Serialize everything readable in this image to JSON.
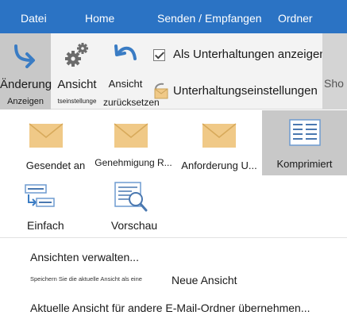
{
  "menubar": {
    "tabs": [
      "Datei",
      "Home",
      "Senden / Empfangen",
      "Ordner"
    ]
  },
  "ribbon": {
    "change_view": {
      "label_top": "Änderung",
      "label_bottom": "Anzeigen",
      "icon": "change-view-arrow-icon"
    },
    "view_settings": {
      "label_top": "Ansicht",
      "label_bottom": "tseinstellunge",
      "icon": "gears-icon"
    },
    "reset_view": {
      "label_top": "Ansicht",
      "label_bottom": "zurücksetzen",
      "icon": "undo-arrow-icon"
    },
    "show_conversations": {
      "label": "Als Unterhaltungen anzeigen",
      "checked": true
    },
    "conversation_settings": {
      "label": "Unterhaltungseinstellungen",
      "icon": "envelope-settings-icon"
    },
    "overflow_label": "Sho"
  },
  "gallery": {
    "items": [
      {
        "label": "Gesendet an",
        "icon": "envelope-icon"
      },
      {
        "label": "Genehmigung R...",
        "icon": "envelope-icon"
      },
      {
        "label": "Anforderung U...",
        "icon": "envelope-icon"
      },
      {
        "label": "Komprimiert",
        "icon": "compact-list-icon",
        "selected": true
      },
      {
        "label": "Einfach",
        "icon": "single-list-icon"
      },
      {
        "label": "Vorschau",
        "icon": "preview-icon"
      }
    ]
  },
  "menu": {
    "manage_views": "Ansichten verwalten...",
    "save_hint": "Speichern Sie die aktuelle Ansicht als eine",
    "new_view": "Neue Ansicht",
    "apply_view": "Aktuelle Ansicht für andere E-Mail-Ordner übernehmen..."
  },
  "colors": {
    "menubar_bg": "#2b73c4",
    "ribbon_bg": "#f3f3f3",
    "selected_bg": "#c8c8c8",
    "icon_blue": "#3a7cc4",
    "envelope": "#f0c987"
  }
}
